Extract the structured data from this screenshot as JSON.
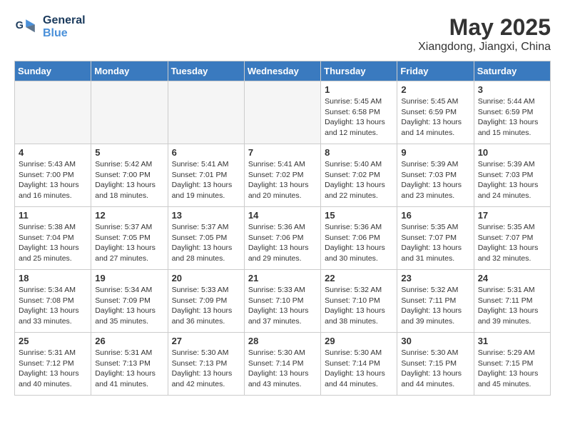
{
  "header": {
    "logo_general": "General",
    "logo_blue": "Blue",
    "month_year": "May 2025",
    "location": "Xiangdong, Jiangxi, China"
  },
  "weekdays": [
    "Sunday",
    "Monday",
    "Tuesday",
    "Wednesday",
    "Thursday",
    "Friday",
    "Saturday"
  ],
  "weeks": [
    [
      {
        "day": "",
        "info": ""
      },
      {
        "day": "",
        "info": ""
      },
      {
        "day": "",
        "info": ""
      },
      {
        "day": "",
        "info": ""
      },
      {
        "day": "1",
        "info": "Sunrise: 5:45 AM\nSunset: 6:58 PM\nDaylight: 13 hours\nand 12 minutes."
      },
      {
        "day": "2",
        "info": "Sunrise: 5:45 AM\nSunset: 6:59 PM\nDaylight: 13 hours\nand 14 minutes."
      },
      {
        "day": "3",
        "info": "Sunrise: 5:44 AM\nSunset: 6:59 PM\nDaylight: 13 hours\nand 15 minutes."
      }
    ],
    [
      {
        "day": "4",
        "info": "Sunrise: 5:43 AM\nSunset: 7:00 PM\nDaylight: 13 hours\nand 16 minutes."
      },
      {
        "day": "5",
        "info": "Sunrise: 5:42 AM\nSunset: 7:00 PM\nDaylight: 13 hours\nand 18 minutes."
      },
      {
        "day": "6",
        "info": "Sunrise: 5:41 AM\nSunset: 7:01 PM\nDaylight: 13 hours\nand 19 minutes."
      },
      {
        "day": "7",
        "info": "Sunrise: 5:41 AM\nSunset: 7:02 PM\nDaylight: 13 hours\nand 20 minutes."
      },
      {
        "day": "8",
        "info": "Sunrise: 5:40 AM\nSunset: 7:02 PM\nDaylight: 13 hours\nand 22 minutes."
      },
      {
        "day": "9",
        "info": "Sunrise: 5:39 AM\nSunset: 7:03 PM\nDaylight: 13 hours\nand 23 minutes."
      },
      {
        "day": "10",
        "info": "Sunrise: 5:39 AM\nSunset: 7:03 PM\nDaylight: 13 hours\nand 24 minutes."
      }
    ],
    [
      {
        "day": "11",
        "info": "Sunrise: 5:38 AM\nSunset: 7:04 PM\nDaylight: 13 hours\nand 25 minutes."
      },
      {
        "day": "12",
        "info": "Sunrise: 5:37 AM\nSunset: 7:05 PM\nDaylight: 13 hours\nand 27 minutes."
      },
      {
        "day": "13",
        "info": "Sunrise: 5:37 AM\nSunset: 7:05 PM\nDaylight: 13 hours\nand 28 minutes."
      },
      {
        "day": "14",
        "info": "Sunrise: 5:36 AM\nSunset: 7:06 PM\nDaylight: 13 hours\nand 29 minutes."
      },
      {
        "day": "15",
        "info": "Sunrise: 5:36 AM\nSunset: 7:06 PM\nDaylight: 13 hours\nand 30 minutes."
      },
      {
        "day": "16",
        "info": "Sunrise: 5:35 AM\nSunset: 7:07 PM\nDaylight: 13 hours\nand 31 minutes."
      },
      {
        "day": "17",
        "info": "Sunrise: 5:35 AM\nSunset: 7:07 PM\nDaylight: 13 hours\nand 32 minutes."
      }
    ],
    [
      {
        "day": "18",
        "info": "Sunrise: 5:34 AM\nSunset: 7:08 PM\nDaylight: 13 hours\nand 33 minutes."
      },
      {
        "day": "19",
        "info": "Sunrise: 5:34 AM\nSunset: 7:09 PM\nDaylight: 13 hours\nand 35 minutes."
      },
      {
        "day": "20",
        "info": "Sunrise: 5:33 AM\nSunset: 7:09 PM\nDaylight: 13 hours\nand 36 minutes."
      },
      {
        "day": "21",
        "info": "Sunrise: 5:33 AM\nSunset: 7:10 PM\nDaylight: 13 hours\nand 37 minutes."
      },
      {
        "day": "22",
        "info": "Sunrise: 5:32 AM\nSunset: 7:10 PM\nDaylight: 13 hours\nand 38 minutes."
      },
      {
        "day": "23",
        "info": "Sunrise: 5:32 AM\nSunset: 7:11 PM\nDaylight: 13 hours\nand 39 minutes."
      },
      {
        "day": "24",
        "info": "Sunrise: 5:31 AM\nSunset: 7:11 PM\nDaylight: 13 hours\nand 39 minutes."
      }
    ],
    [
      {
        "day": "25",
        "info": "Sunrise: 5:31 AM\nSunset: 7:12 PM\nDaylight: 13 hours\nand 40 minutes."
      },
      {
        "day": "26",
        "info": "Sunrise: 5:31 AM\nSunset: 7:13 PM\nDaylight: 13 hours\nand 41 minutes."
      },
      {
        "day": "27",
        "info": "Sunrise: 5:30 AM\nSunset: 7:13 PM\nDaylight: 13 hours\nand 42 minutes."
      },
      {
        "day": "28",
        "info": "Sunrise: 5:30 AM\nSunset: 7:14 PM\nDaylight: 13 hours\nand 43 minutes."
      },
      {
        "day": "29",
        "info": "Sunrise: 5:30 AM\nSunset: 7:14 PM\nDaylight: 13 hours\nand 44 minutes."
      },
      {
        "day": "30",
        "info": "Sunrise: 5:30 AM\nSunset: 7:15 PM\nDaylight: 13 hours\nand 44 minutes."
      },
      {
        "day": "31",
        "info": "Sunrise: 5:29 AM\nSunset: 7:15 PM\nDaylight: 13 hours\nand 45 minutes."
      }
    ]
  ]
}
